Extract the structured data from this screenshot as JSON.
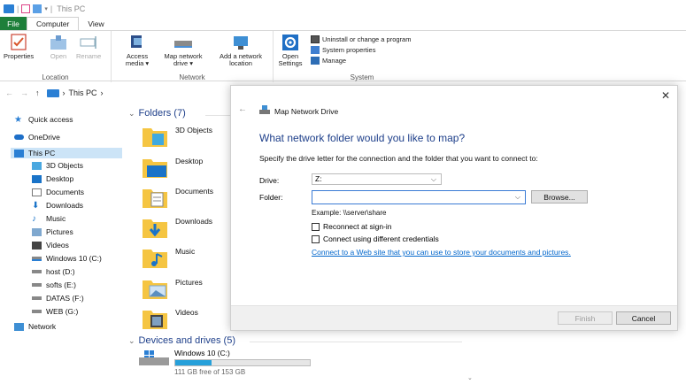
{
  "window": {
    "title": "This PC"
  },
  "ribbon": {
    "tabs": [
      {
        "label": "File"
      },
      {
        "label": "Computer"
      },
      {
        "label": "View"
      }
    ],
    "groups": {
      "location": {
        "label": "Location",
        "buttons": [
          {
            "label": "Properties"
          },
          {
            "label": "Open"
          },
          {
            "label": "Rename"
          }
        ]
      },
      "network": {
        "label": "Network",
        "buttons": [
          {
            "label": "Access media ▾"
          },
          {
            "label": "Map network drive ▾"
          },
          {
            "label": "Add a network location"
          }
        ]
      },
      "system": {
        "label": "System",
        "open_settings": "Open Settings",
        "small": [
          {
            "label": "Uninstall or change a program"
          },
          {
            "label": "System properties"
          },
          {
            "label": "Manage"
          }
        ]
      }
    }
  },
  "address": {
    "back": "←",
    "forward": "→",
    "up": "↑",
    "crumb": "This PC",
    "sep": "›"
  },
  "nav": {
    "items": [
      {
        "label": "Quick access"
      },
      {
        "label": "OneDrive"
      },
      {
        "label": "This PC"
      },
      {
        "label": "3D Objects"
      },
      {
        "label": "Desktop"
      },
      {
        "label": "Documents"
      },
      {
        "label": "Downloads"
      },
      {
        "label": "Music"
      },
      {
        "label": "Pictures"
      },
      {
        "label": "Videos"
      },
      {
        "label": "Windows 10 (C:)"
      },
      {
        "label": "host (D:)"
      },
      {
        "label": "softs (E:)"
      },
      {
        "label": "DATAS (F:)"
      },
      {
        "label": "WEB (G:)"
      },
      {
        "label": "Network"
      }
    ]
  },
  "content": {
    "folders_header": "Folders (7)",
    "folders": [
      {
        "name": "3D Objects"
      },
      {
        "name": "Desktop"
      },
      {
        "name": "Documents"
      },
      {
        "name": "Downloads"
      },
      {
        "name": "Music"
      },
      {
        "name": "Pictures"
      },
      {
        "name": "Videos"
      }
    ],
    "devices_header": "Devices and drives (5)",
    "drive": {
      "name": "Windows 10 (C:)",
      "free": "111 GB free of 153 GB",
      "used_fraction": 0.27
    }
  },
  "dialog": {
    "title": "Map Network Drive",
    "close": "✕",
    "back": "←",
    "heading": "What network folder would you like to map?",
    "instruction": "Specify the drive letter for the connection and the folder that you want to connect to:",
    "drive_label": "Drive:",
    "drive_value": "Z:",
    "folder_label": "Folder:",
    "folder_value": "",
    "browse_label": "Browse...",
    "example": "Example: \\\\server\\share",
    "reconnect_label": "Reconnect at sign-in",
    "credentials_label": "Connect using different credentials",
    "link": "Connect to a Web site that you can use to store your documents and pictures",
    "finish_label": "Finish",
    "cancel_label": "Cancel"
  },
  "colors": {
    "accent": "#1e3f8a",
    "file_tab": "#1e7f3a",
    "folder": "#f5c542",
    "link": "#0066cc",
    "drive_fill": "#26a0da"
  }
}
